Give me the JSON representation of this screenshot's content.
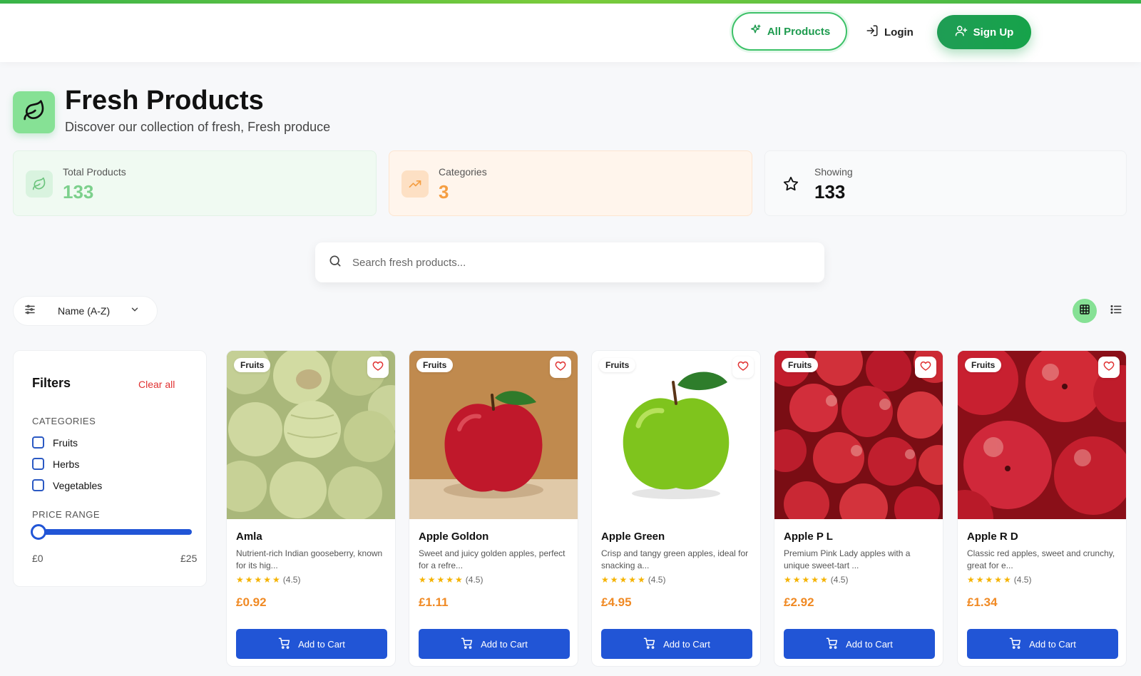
{
  "nav": {
    "all_products": "All Products",
    "login": "Login",
    "signup": "Sign Up"
  },
  "header": {
    "title": "Fresh Products",
    "subtitle": "Discover our collection of fresh, Fresh produce"
  },
  "stats": {
    "total": {
      "label": "Total Products",
      "value": "133"
    },
    "categories": {
      "label": "Categories",
      "value": "3"
    },
    "showing": {
      "label": "Showing",
      "value": "133"
    }
  },
  "search": {
    "placeholder": "Search fresh products...",
    "value": ""
  },
  "sort": {
    "selected": "Name (A-Z)"
  },
  "filters": {
    "title": "Filters",
    "clear": "Clear all",
    "categories_heading": "CATEGORIES",
    "categories": [
      "Fruits",
      "Herbs",
      "Vegetables"
    ],
    "price_heading": "PRICE RANGE",
    "price_min": "£0",
    "price_max": "£25"
  },
  "products": [
    {
      "badge": "Fruits",
      "name": "Amla",
      "desc": "Nutrient-rich Indian gooseberry, known for its hig...",
      "rating": "(4.5)",
      "price": "£0.92",
      "cta": "Add to Cart"
    },
    {
      "badge": "Fruits",
      "name": "Apple Goldon",
      "desc": "Sweet and juicy golden apples, perfect for a refre...",
      "rating": "(4.5)",
      "price": "£1.11",
      "cta": "Add to Cart"
    },
    {
      "badge": "Fruits",
      "name": "Apple Green",
      "desc": "Crisp and tangy green apples, ideal for snacking a...",
      "rating": "(4.5)",
      "price": "£4.95",
      "cta": "Add to Cart"
    },
    {
      "badge": "Fruits",
      "name": "Apple P L",
      "desc": "Premium Pink Lady apples with a unique sweet-tart ...",
      "rating": "(4.5)",
      "price": "£2.92",
      "cta": "Add to Cart"
    },
    {
      "badge": "Fruits",
      "name": "Apple R D",
      "desc": "Classic red apples, sweet and crunchy, great for e...",
      "rating": "(4.5)",
      "price": "£1.34",
      "cta": "Add to Cart"
    }
  ],
  "colors": {
    "accent": "#2155d6",
    "brand": "#1f9d55",
    "price": "#f08a24"
  }
}
